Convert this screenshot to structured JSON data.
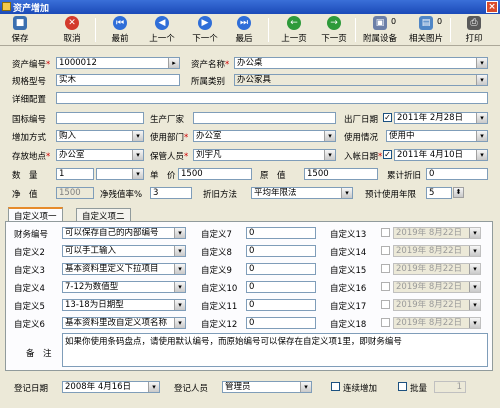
{
  "window": {
    "title": "资产增加",
    "close_label": "×"
  },
  "toolbar": {
    "save": "保存",
    "cancel": "取消",
    "first": "最前",
    "prev": "上一个",
    "next": "下一个",
    "last": "最后",
    "prev_page": "上一页",
    "next_page": "下一页",
    "attach": "附属设备",
    "attach_count": "0",
    "photos": "相关图片",
    "photos_count": "0",
    "print": "打印"
  },
  "form": {
    "asset_no_label": "资产编号",
    "asset_no": "1000012",
    "asset_name_label": "资产名称",
    "asset_name": "办公桌",
    "spec_label": "规格型号",
    "spec": "实木",
    "category_label": "所属类别",
    "category": "办公家具",
    "detail_label": "详细配置",
    "detail": "",
    "intl_no_label": "国标编号",
    "intl_no": "",
    "maker_label": "生产厂家",
    "maker": "",
    "mfg_date_label": "出厂日期",
    "mfg_date": "2011年 2月28日",
    "add_method_label": "增加方式",
    "add_method": "购入",
    "dept_label": "使用部门",
    "dept": "办公室",
    "usage_label": "使用情况",
    "usage": "使用中",
    "location_label": "存放地点",
    "location": "办公室",
    "keeper_label": "保管人员",
    "keeper": "刘宇凡",
    "entry_date_label": "入帐日期",
    "entry_date": "2011年 4月10日",
    "qty_label": "数　量",
    "qty": "1",
    "unit": "",
    "price_label": "单　价",
    "price": "1500",
    "orig_label": "原　值",
    "orig": "1500",
    "accum_label": "累计折旧",
    "accum": "0",
    "net_label": "净　值",
    "net": "1500",
    "residual_label": "净残值率%",
    "residual": "3",
    "method_label": "折旧方法",
    "method": "平均年限法",
    "years_label": "预计使用年限",
    "years": "5"
  },
  "tabs": [
    "自定义项一",
    "自定义项二"
  ],
  "custom": {
    "rows": [
      {
        "label": "财务编号",
        "value": "可以保存自己的内部编号",
        "mid_label": "自定义7",
        "mid_value": "0",
        "right_label": "自定义13",
        "right_value": "2019年 8月22日"
      },
      {
        "label": "自定义2",
        "value": "可以手工输入",
        "mid_label": "自定义8",
        "mid_value": "0",
        "right_label": "自定义14",
        "right_value": "2019年 8月22日"
      },
      {
        "label": "自定义3",
        "value": "基本资料里定义下拉项目",
        "mid_label": "自定义9",
        "mid_value": "0",
        "right_label": "自定义15",
        "right_value": "2019年 8月22日"
      },
      {
        "label": "自定义4",
        "value": "7-12为数值型",
        "mid_label": "自定义10",
        "mid_value": "0",
        "right_label": "自定义16",
        "right_value": "2019年 8月22日"
      },
      {
        "label": "自定义5",
        "value": "13-18为日期型",
        "mid_label": "自定义11",
        "mid_value": "0",
        "right_label": "自定义17",
        "right_value": "2019年 8月22日"
      },
      {
        "label": "自定义6",
        "value": "基本资料里改自定义项名称",
        "mid_label": "自定义12",
        "mid_value": "0",
        "right_label": "自定义18",
        "right_value": "2019年 8月22日"
      }
    ],
    "remark_label": "备　注",
    "remark": "如果你使用条码盘点，请使用默认编号，而原始编号可以保存在自定义项1里，即财务编号"
  },
  "footer": {
    "reg_date_label": "登记日期",
    "reg_date": "2008年 4月16日",
    "reg_user_label": "登记人员",
    "reg_user": "管理员",
    "continuous_label": "连续增加",
    "batch_label": "批量",
    "batch_value": "1"
  },
  "colors": {
    "title_bg": "#1b4ab8",
    "window_bg": "#ece9d8",
    "required": "#d00000"
  }
}
